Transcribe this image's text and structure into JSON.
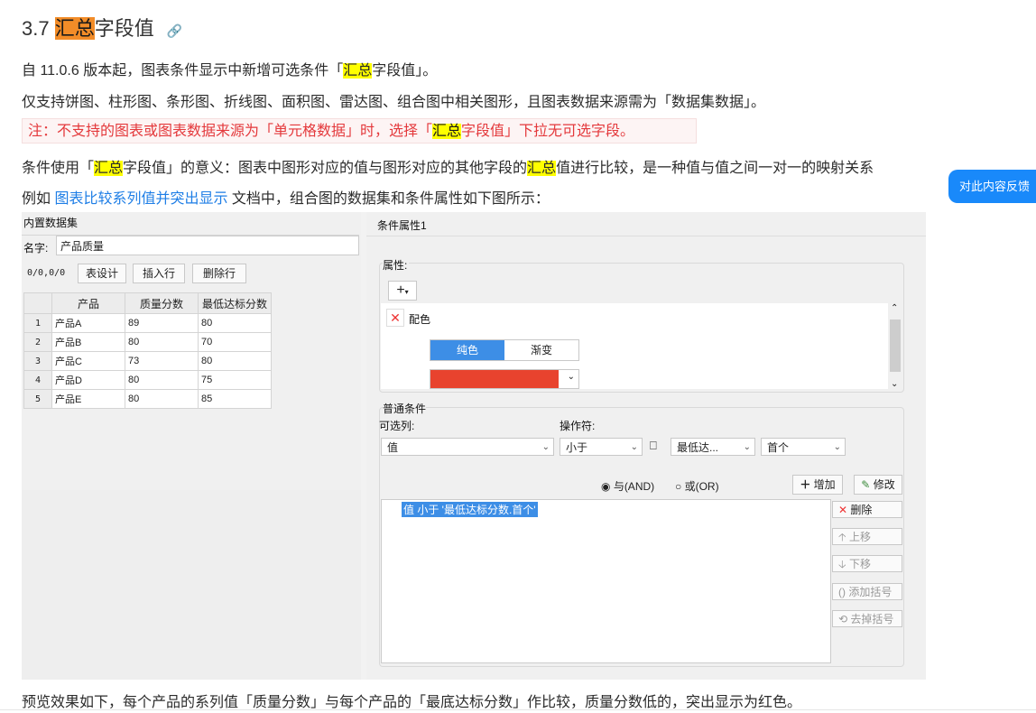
{
  "heading": {
    "num": "3.7 ",
    "hl": "汇总",
    "rest": "字段值",
    "anchor_icon": "link-icon"
  },
  "p1": {
    "a": "自 11.0.6 版本起，图表条件显示中新增可选条件「",
    "hl": "汇总",
    "b": "字段值」。"
  },
  "p2": "仅支持饼图、柱形图、条形图、折线图、面积图、雷达图、组合图中相关图形，且图表数据来源需为「数据集数据」。",
  "note": {
    "a": "注：不支持的图表或图表数据来源为「单元格数据」时，选择「",
    "hl": "汇总",
    "b": "字段值」下拉无可选字段。"
  },
  "p3": {
    "a": "条件使用「",
    "hl1": "汇总",
    "b": "字段值」的意义：图表中图形对应的值与图形对应的其他字段的",
    "hl2": "汇总",
    "c": "值进行比较，是一种值与值之间一对一的映射关系"
  },
  "p4": {
    "a": "例如 ",
    "link": "图表比较系列值并突出显示",
    "b": " 文档中，组合图的数据集和条件属性如下图所示："
  },
  "p5": "预览效果如下，每个产品的系列值「质量分数」与每个产品的「最底达标分数」作比较，质量分数低的，突出显示为红色。",
  "feedback": "对此内容反馈",
  "dataset": {
    "title": "内置数据集",
    "name_label": "名字:",
    "name_value": "产品质量",
    "counter": "0/0,0/0",
    "btn_design": "表设计",
    "btn_insert": "插入行",
    "btn_delete": "删除行",
    "columns": [
      "产品",
      "质量分数",
      "最低达标分数"
    ],
    "rows": [
      [
        "1",
        "产品A",
        "89",
        "80"
      ],
      [
        "2",
        "产品B",
        "80",
        "70"
      ],
      [
        "3",
        "产品C",
        "73",
        "80"
      ],
      [
        "4",
        "产品D",
        "80",
        "75"
      ],
      [
        "5",
        "产品E",
        "80",
        "85"
      ]
    ]
  },
  "cond": {
    "title": "条件属性1",
    "attr_label": "属性:",
    "add_icon": "+",
    "color_label": "配色",
    "tab_solid": "纯色",
    "tab_gradient": "渐变",
    "swatch_color": "#e8432e",
    "normal_label": "普通条件",
    "col_label": "可选列:",
    "op_label": "操作符:",
    "col_value": "值",
    "op_value": "小于",
    "field_value": "最低达...",
    "agg_value": "首个",
    "and_label": "与(AND)",
    "or_label": "或(OR)",
    "add_btn": "增加",
    "edit_btn": "修改",
    "expr": "值 小于 '最低达标分数.首个'",
    "del_btn": "删除",
    "up_btn": "上移",
    "down_btn": "下移",
    "addp_btn": "添加括号",
    "rmp_btn": "去掉括号"
  }
}
